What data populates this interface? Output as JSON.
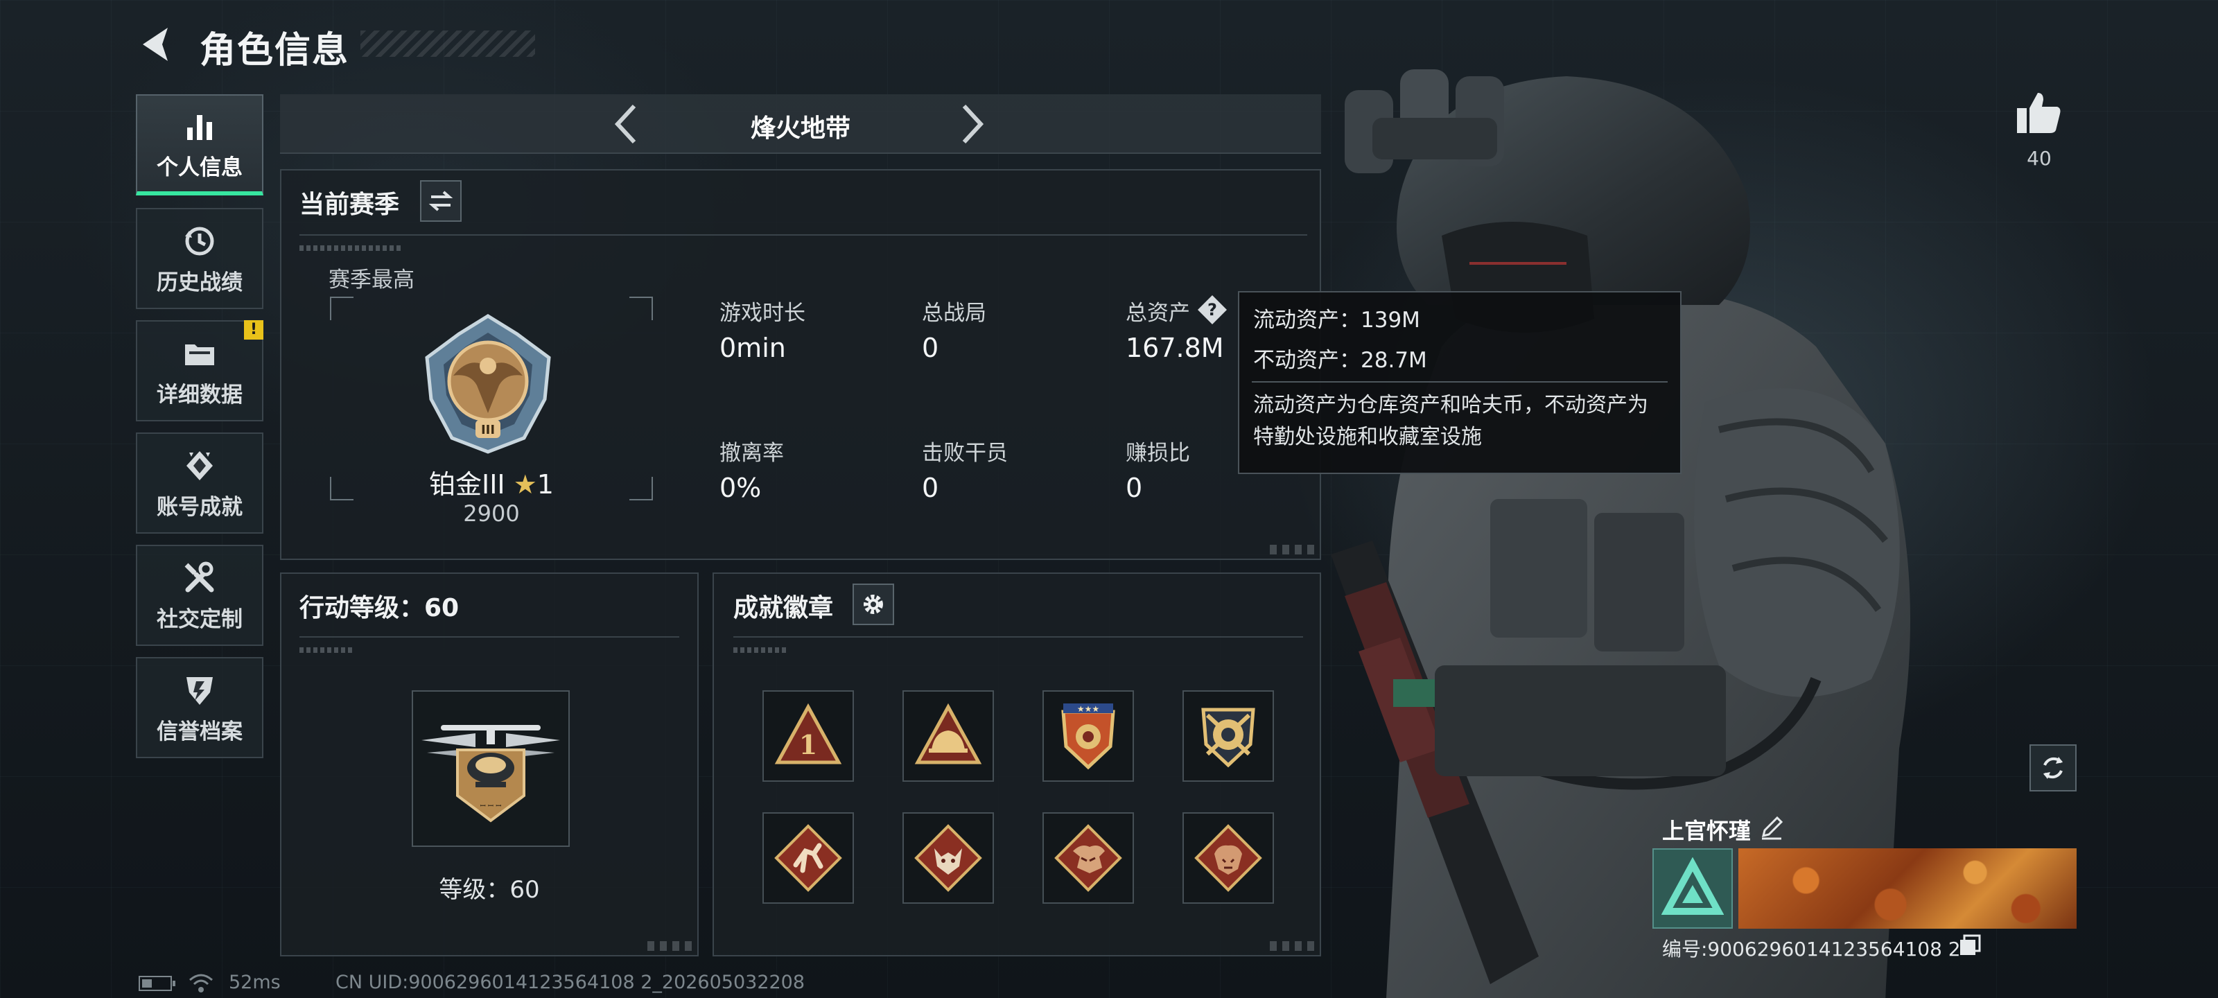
{
  "header": {
    "title": "角色信息"
  },
  "nav": {
    "items": [
      {
        "label": "个人信息",
        "active": true
      },
      {
        "label": "历史战绩"
      },
      {
        "label": "详细数据",
        "badge": "!"
      },
      {
        "label": "账号成就"
      },
      {
        "label": "社交定制"
      },
      {
        "label": "信誉档案"
      }
    ]
  },
  "mode": {
    "title": "烽火地带"
  },
  "season": {
    "header": "当前赛季",
    "best_label": "赛季最高",
    "rank_name": "铂金III",
    "rank_star": "★",
    "rank_stars": "1",
    "rank_score": "2900",
    "stats": [
      {
        "label": "游戏时长",
        "value": "0min"
      },
      {
        "label": "总战局",
        "value": "0"
      },
      {
        "label": "总资产",
        "value": "167.8M"
      },
      {
        "label": "撤离率",
        "value": "0%"
      },
      {
        "label": "击败干员",
        "value": "0"
      },
      {
        "label": "赚损比",
        "value": "0"
      }
    ]
  },
  "tooltip": {
    "liquid": "流动资产：139M",
    "fixed": "不动资产：28.7M",
    "description": "流动资产为仓库资产和哈夫币，不动资产为特勤处设施和收藏室设施"
  },
  "action_level": {
    "header": "行动等级：60",
    "level_label": "等级：60"
  },
  "badges": {
    "header": "成就徽章",
    "items": [
      "badge-1",
      "badge-2",
      "badge-3",
      "badge-4",
      "badge-5",
      "badge-6",
      "badge-7",
      "badge-8"
    ]
  },
  "likes": {
    "count": "40"
  },
  "player": {
    "name": "上官怀瑾",
    "id_text": "编号:9006296014123564108 2"
  },
  "status_bar": {
    "ping": "52ms",
    "uid": "CN UID:9006296014123564108 2_202605032208"
  },
  "colors": {
    "accent": "#37e6a0",
    "gold": "#e4bf5a",
    "warning": "#e9c21a"
  }
}
